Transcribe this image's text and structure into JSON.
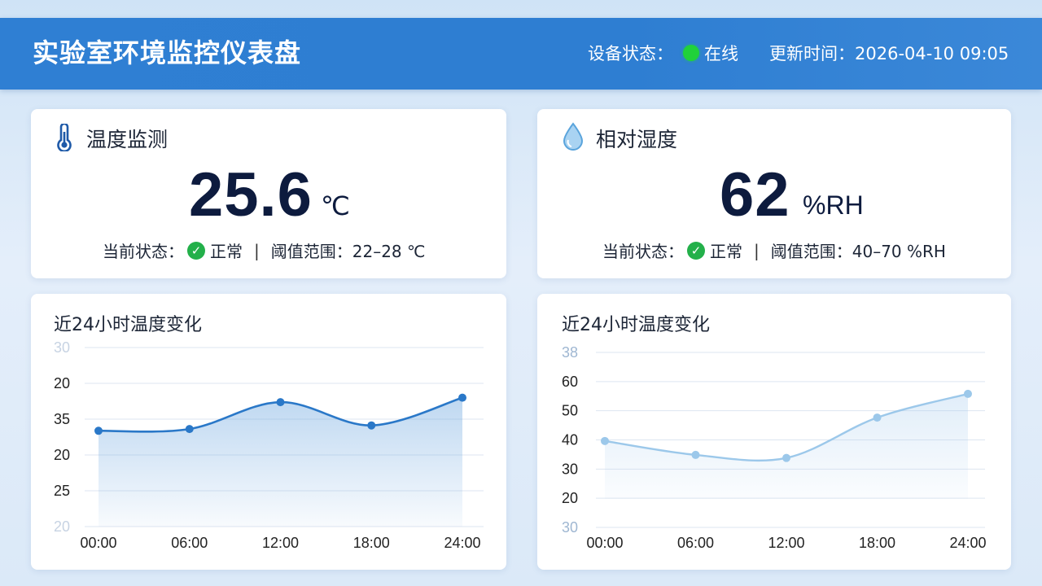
{
  "header": {
    "title": "实验室环境监控仪表盘",
    "device_status_label": "设备状态：",
    "device_status_value": "在线",
    "update_time": "更新时间：2026-04-10 09:05"
  },
  "colors": {
    "header_bg": "#2f7fd3",
    "online": "#20d23a",
    "ok": "#23b04a",
    "temp_line": "#2a78c8",
    "humidity_line": "#9cc8ea"
  },
  "temperature_card": {
    "title": "温度监测",
    "icon": "thermometer-icon",
    "value": "25.6",
    "unit": "℃",
    "status_label": "当前状态：",
    "status_value": "正常",
    "separator": "|",
    "threshold": "阈值范围：22–28 ℃"
  },
  "humidity_card": {
    "title": "相对湿度",
    "icon": "water-drop-icon",
    "value": "62",
    "unit": "%RH",
    "status_label": "当前状态：",
    "status_value": "正常",
    "separator": "|",
    "threshold": "阈值范围：40–70 %RH"
  },
  "chart_data": [
    {
      "type": "area",
      "title": "近24小时温度变化",
      "x": [
        "00:00",
        "06:00",
        "12:00",
        "18:00",
        "24:00"
      ],
      "y_tick_labels": [
        "30",
        "20",
        "35",
        "20",
        "25",
        "20"
      ],
      "values": [
        30.7,
        30.9,
        33.9,
        31.3,
        34.4
      ],
      "ylim": [
        20,
        40
      ],
      "grid": true
    },
    {
      "type": "area",
      "title": "近24小时温度变化",
      "x": [
        "00:00",
        "06:00",
        "12:00",
        "18:00",
        "24:00"
      ],
      "y_tick_labels": [
        "38",
        "60",
        "50",
        "40",
        "30",
        "20",
        "30"
      ],
      "values": [
        43.4,
        39.3,
        38.4,
        50.3,
        57.3
      ],
      "ylim": [
        10,
        70
      ],
      "grid": true
    }
  ]
}
